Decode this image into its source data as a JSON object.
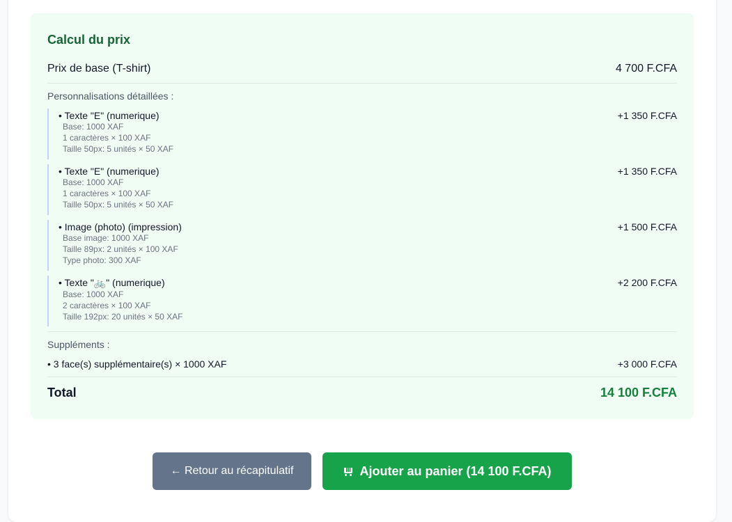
{
  "price_panel": {
    "title": "Calcul du prix",
    "base": {
      "label": "Prix de base (T-shirt)",
      "amount": "4 700 F.CFA"
    },
    "customizations_label": "Personnalisations détaillées :",
    "customizations": [
      {
        "title": "• Texte \"E\" (numerique)",
        "amount": "+1 350 F.CFA",
        "details": [
          "Base: 1000 XAF",
          "1 caractères × 100 XAF",
          "Taille 50px: 5 unités × 50 XAF"
        ]
      },
      {
        "title": "• Texte \"E\" (numerique)",
        "amount": "+1 350 F.CFA",
        "details": [
          "Base: 1000 XAF",
          "1 caractères × 100 XAF",
          "Taille 50px: 5 unités × 50 XAF"
        ]
      },
      {
        "title": "• Image (photo) (impression)",
        "amount": "+1 500 F.CFA",
        "details": [
          "Base image: 1000 XAF",
          "Taille 89px: 2 unités × 100 XAF",
          "Type photo: 300 XAF"
        ]
      },
      {
        "title": "• Texte \"🚲\" (numerique)",
        "amount": "+2 200 F.CFA",
        "details": [
          "Base: 1000 XAF",
          "2 caractères × 100 XAF",
          "Taille 192px: 20 unités × 50 XAF"
        ]
      }
    ],
    "extras_label": "Suppléments :",
    "extras": {
      "label": "• 3 face(s) supplémentaire(s) × 1000 XAF",
      "amount": "+3 000 F.CFA"
    },
    "total": {
      "label": "Total",
      "amount": "14 100 F.CFA"
    }
  },
  "actions": {
    "back_icon": "arrow-left-icon",
    "back_label": "← Retour au récapitulatif",
    "add_icon": "cart-icon",
    "add_label": "Ajouter au panier (14 100 F.CFA)"
  },
  "colors": {
    "panel_bg": "#f0fdf4",
    "title_green": "#166534",
    "total_green": "#15803d",
    "back_button": "#64748b",
    "add_button": "#16a34a"
  }
}
